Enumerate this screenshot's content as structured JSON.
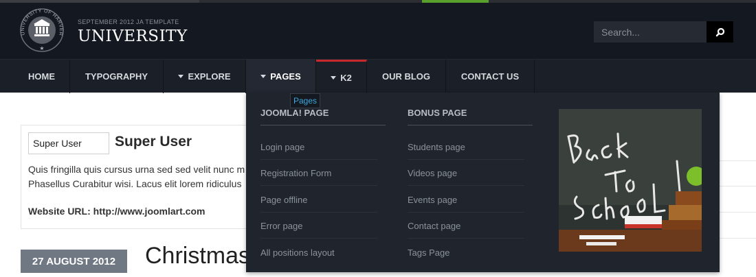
{
  "header": {
    "tagline": "September 2012 JA Template",
    "site_name": "UNIVERSITY",
    "logo_text": "UNIVERSITY OF HARVERDE",
    "search_placeholder": "Search...",
    "colors": {
      "header_bg": "#141821",
      "nav_bg": "#1b1f27",
      "accent_red": "#c8282c",
      "accent_green": "#5aa02c"
    }
  },
  "nav": {
    "items": [
      {
        "label": "HOME",
        "has_caret": false
      },
      {
        "label": "TYPOGRAPHY",
        "has_caret": false
      },
      {
        "label": "EXPLORE",
        "has_caret": true
      },
      {
        "label": "PAGES",
        "has_caret": true
      },
      {
        "label": "K2",
        "has_caret": true
      },
      {
        "label": "OUR BLOG",
        "has_caret": false
      },
      {
        "label": "CONTACT US",
        "has_caret": false
      }
    ],
    "tooltip": "Pages"
  },
  "mega_menu": {
    "columns": [
      {
        "heading": "JOOMLA! PAGE",
        "items": [
          "Login page",
          "Registration Form",
          "Page offline",
          "Error page",
          "All positions layout"
        ]
      },
      {
        "heading": "BONUS PAGE",
        "items": [
          "Students page",
          "Videos page",
          "Events page",
          "Contact page",
          "Tags Page"
        ]
      }
    ],
    "image_text": "Back To School !"
  },
  "author": {
    "input_value": "Super User",
    "name": "Super User",
    "desc_line1": "Quis fringilla quis cursus urna sed sed velit nunc m",
    "desc_line2": "Phasellus Curabitur wisi. Lacus elit lorem ridiculus",
    "url_label": "Website URL:",
    "url": "http://www.joomlart.com"
  },
  "post": {
    "date": "27 AUGUST 2012",
    "title": "Christmas"
  }
}
